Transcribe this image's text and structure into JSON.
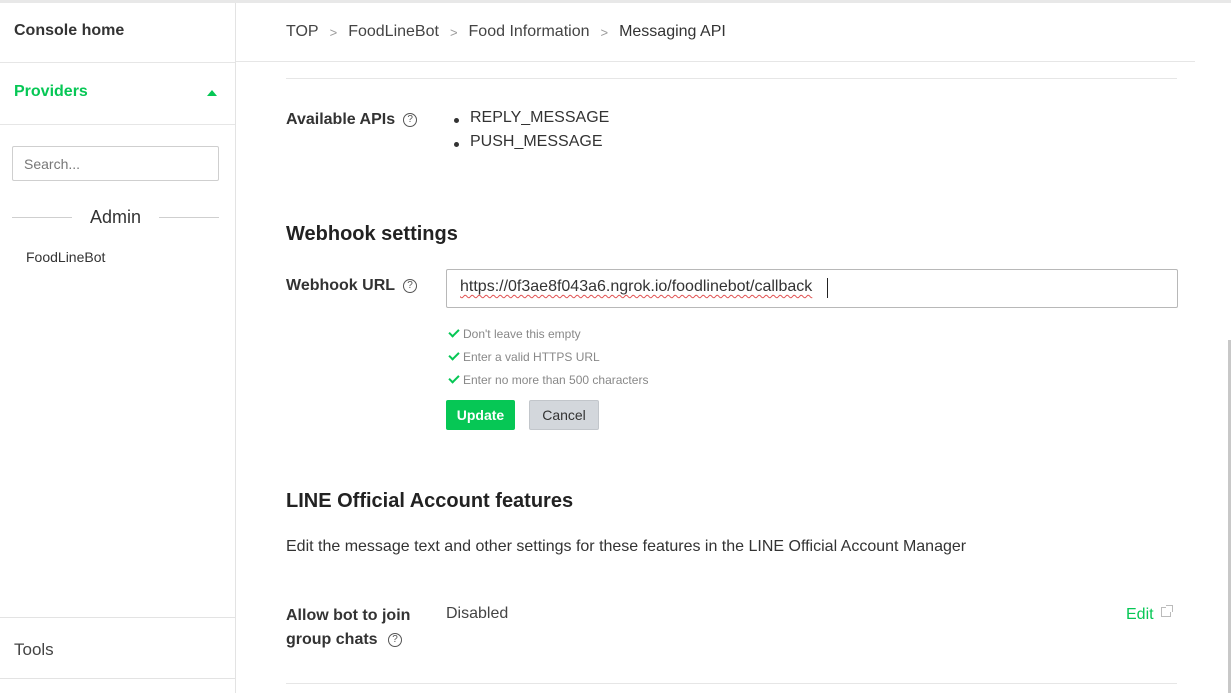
{
  "sidebar": {
    "console_home": "Console home",
    "providers": "Providers",
    "search_placeholder": "Search...",
    "section_label": "Admin",
    "items": [
      {
        "label": "FoodLineBot"
      }
    ],
    "tools": "Tools"
  },
  "breadcrumb": {
    "items": [
      "TOP",
      "FoodLineBot",
      "Food Information",
      "Messaging API"
    ],
    "separator": ">"
  },
  "available_apis": {
    "label": "Available APIs",
    "items": [
      "REPLY_MESSAGE",
      "PUSH_MESSAGE"
    ]
  },
  "webhook": {
    "heading": "Webhook settings",
    "url_label": "Webhook URL",
    "url_value": "https://0f3ae8f043a6.ngrok.io/foodlinebot/callback",
    "validations": [
      "Don't leave this empty",
      "Enter a valid HTTPS URL",
      "Enter no more than 500 characters"
    ],
    "update_label": "Update",
    "cancel_label": "Cancel"
  },
  "oa_features": {
    "heading": "LINE Official Account features",
    "description": "Edit the message text and other settings for these features in the LINE Official Account Manager",
    "group_chat_label": "Allow bot to join group chats",
    "group_chat_value": "Disabled",
    "edit_label": "Edit"
  },
  "colors": {
    "accent": "#06c755",
    "cancel_bg": "#d3d7dc"
  },
  "icons": {
    "help": "question-circle-icon",
    "check": "check-icon",
    "external": "external-link-icon",
    "caret": "caret-up-icon"
  }
}
